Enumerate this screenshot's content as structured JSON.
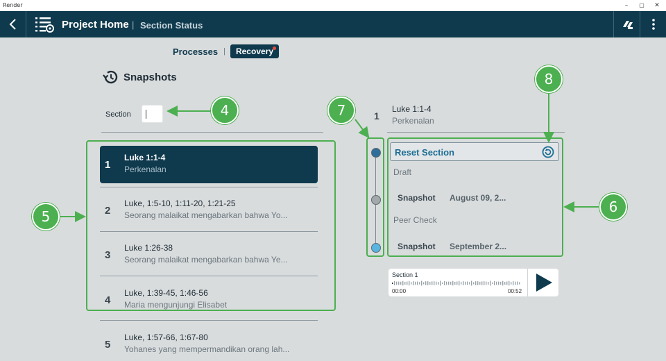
{
  "window": {
    "title": "Render",
    "minimize": "–",
    "maximize": "▢",
    "close": "✕"
  },
  "header": {
    "title": "Project Home",
    "separator": "|",
    "subtitle": "Section Status"
  },
  "tabs": [
    {
      "label": "Processes",
      "active": false
    },
    {
      "label": "Recovery",
      "active": true,
      "has_notification": true
    }
  ],
  "tab_separator": "|",
  "snapshots": {
    "title": "Snapshots",
    "section_label": "Section",
    "section_value": ""
  },
  "sections": [
    {
      "number": "1",
      "reference": "Luke 1:1-4",
      "description": "Perkenalan",
      "selected": true
    },
    {
      "number": "2",
      "reference": "Luke, 1:5-10, 1:11-20, 1:21-25",
      "description": "Seorang malaikat mengabarkan bahwa Yo..."
    },
    {
      "number": "3",
      "reference": "Luke 1:26-38",
      "description": "Seorang malaikat mengabarkan bahwa Ye..."
    },
    {
      "number": "4",
      "reference": "Luke, 1:39-45, 1:46-56",
      "description": "Maria mengunjungi Elisabet"
    },
    {
      "number": "5",
      "reference": "Luke, 1:57-66, 1:67-80",
      "description": "Yohanes yang mempermandikan orang lah..."
    }
  ],
  "detail": {
    "number": "1",
    "reference": "Luke 1:1-4",
    "description": "Perkenalan",
    "reset_label": "Reset Section",
    "stages": [
      {
        "name": "Draft",
        "snapshot_label": "Snapshot",
        "date": "August 09, 2..."
      },
      {
        "name": "Peer Check",
        "snapshot_label": "Snapshot",
        "date": "September 2..."
      }
    ],
    "timeline_colors": [
      "#2f6e98",
      "#a3a8ab",
      "#58b4e0"
    ]
  },
  "player": {
    "label": "Section 1",
    "current_time": "00:00",
    "duration": "00:52",
    "progress": 0
  },
  "annotations": [
    {
      "number": "4"
    },
    {
      "number": "5"
    },
    {
      "number": "6"
    },
    {
      "number": "7"
    },
    {
      "number": "8"
    }
  ],
  "colors": {
    "primary": "#0f3a4e",
    "accent": "#1c6c93",
    "annotation": "#4caf50",
    "notification": "#e84b3c"
  }
}
